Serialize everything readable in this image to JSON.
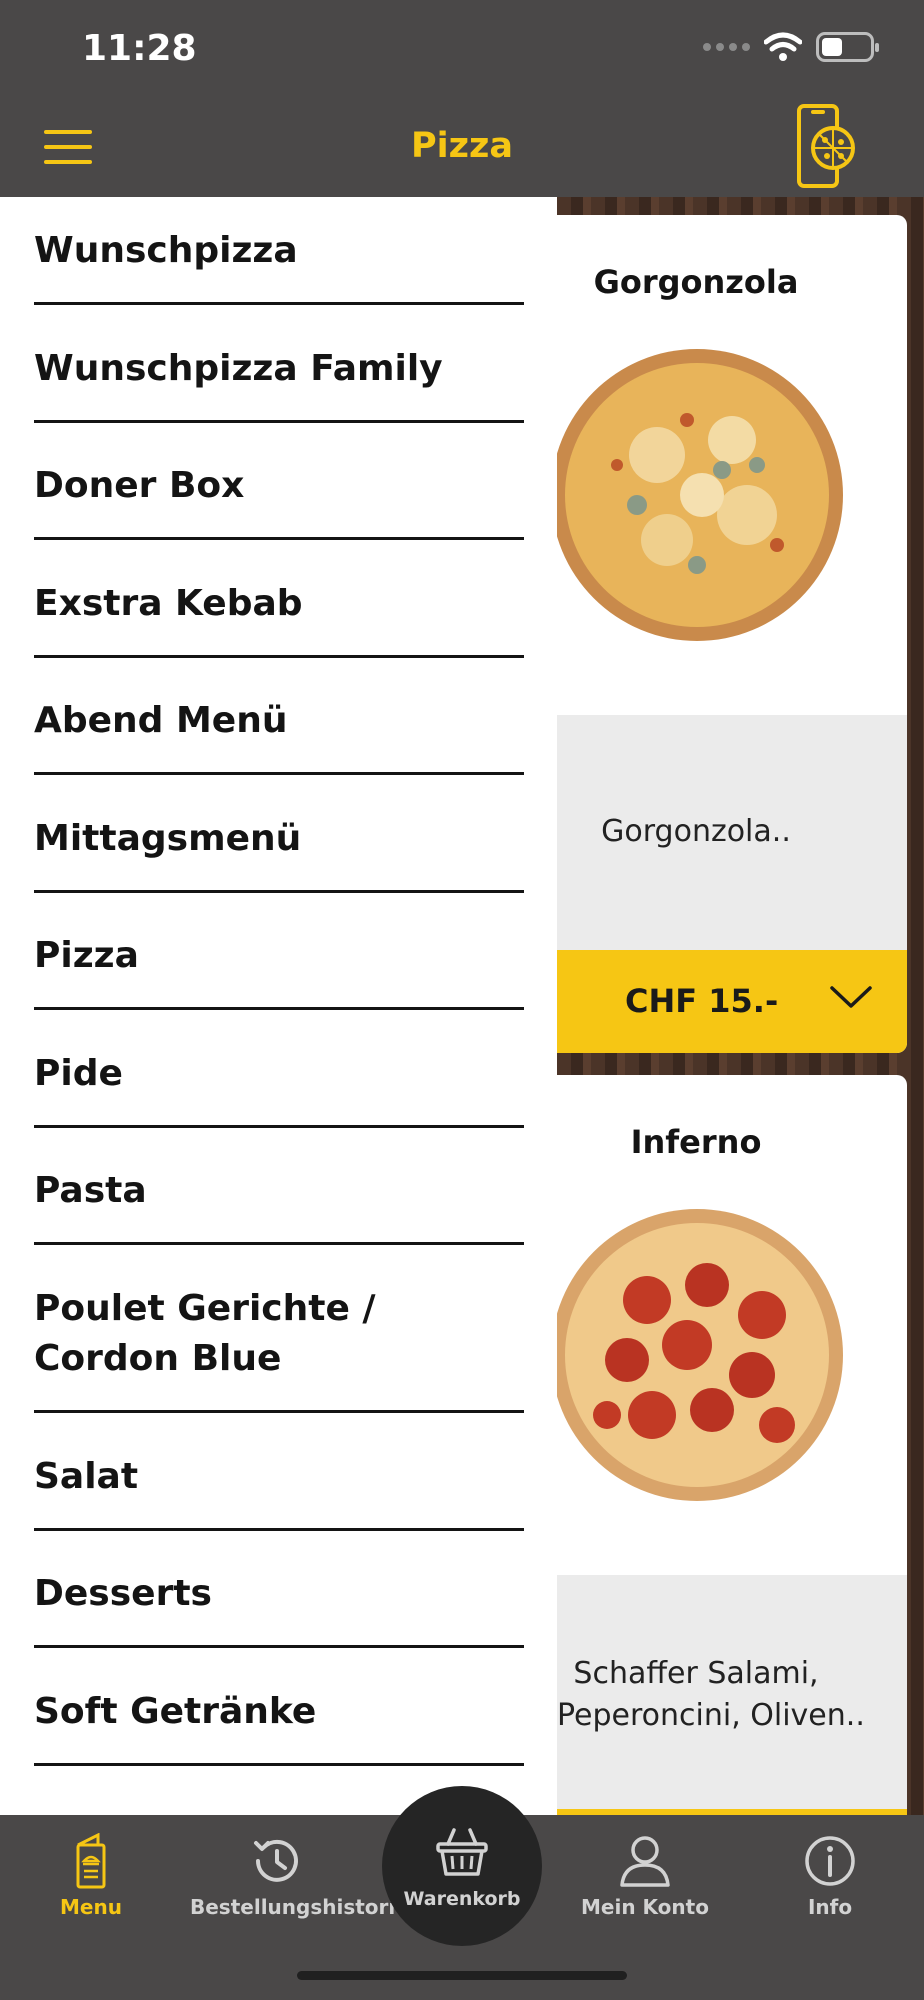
{
  "status_bar": {
    "time": "11:28"
  },
  "header": {
    "title": "Pizza"
  },
  "drawer": {
    "items": [
      {
        "label": "Wunschpizza"
      },
      {
        "label": "Wunschpizza Family"
      },
      {
        "label": "Doner Box"
      },
      {
        "label": "Exstra Kebab"
      },
      {
        "label": "Abend Menü"
      },
      {
        "label": "Mittagsmenü"
      },
      {
        "label": "Pizza"
      },
      {
        "label": "Pide"
      },
      {
        "label": "Pasta"
      },
      {
        "label": "Poulet Gerichte / Cordon Blue"
      },
      {
        "label": "Salat"
      },
      {
        "label": "Desserts"
      },
      {
        "label": "Soft Getränke"
      }
    ]
  },
  "products": [
    {
      "name": "Gorgonzola",
      "description": "Gorgonzola..",
      "price": "CHF 15.-"
    },
    {
      "name": "Inferno",
      "description_line1": "Schaffer Salami,",
      "description_line2": "Peperoncini, Oliven.."
    }
  ],
  "tabbar": {
    "menu": "Menu",
    "history": "Bestellungshistorie",
    "cart": "Warenkorb",
    "account": "Mein Konto",
    "info": "Info"
  },
  "colors": {
    "accent": "#f6c614",
    "bar": "#4a4848",
    "text": "#141414"
  },
  "icons": {
    "menu_toggle": "hamburger-icon",
    "logo": "phone-pizza-icon",
    "expand": "chevron-down-icon",
    "tab_menu": "menu-card-icon",
    "tab_history": "history-icon",
    "tab_cart": "basket-icon",
    "tab_account": "user-icon",
    "tab_info": "info-icon"
  }
}
